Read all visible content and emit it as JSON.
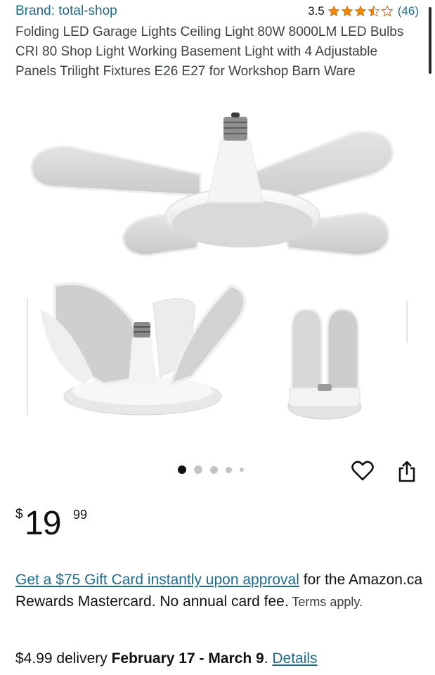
{
  "header": {
    "brand": "Brand: total-shop",
    "rating_value": "3.5",
    "rating_stars": 3.5,
    "rating_count": "(46)",
    "star_color": "#f08804"
  },
  "product": {
    "title": "Folding LED Garage Lights Ceiling Light 80W 8000LM LED Bulbs CRI 80 Shop Light Working Basement Light with 4 Adjustable Panels Trilight Fixtures E26 E27 for Workshop Barn Ware"
  },
  "gallery": {
    "images": [
      "main-fan-light-image",
      "panels-open-image",
      "panels-folded-image"
    ],
    "image_count": 5,
    "active_index": 0
  },
  "price": {
    "symbol": "$",
    "whole": "19",
    "fraction": "99"
  },
  "promo": {
    "link_text": "Get a $75 Gift Card instantly upon approval",
    "text": " for the Amazon.ca Rewards Mastercard. No annual card fee.",
    "terms": " Terms apply."
  },
  "delivery": {
    "prefix": "$4.99 delivery ",
    "dates": "February 17 - March 9",
    "suffix": ". ",
    "details_link": "Details"
  },
  "colors": {
    "link": "#1f6b8f",
    "text": "#0f1111"
  }
}
